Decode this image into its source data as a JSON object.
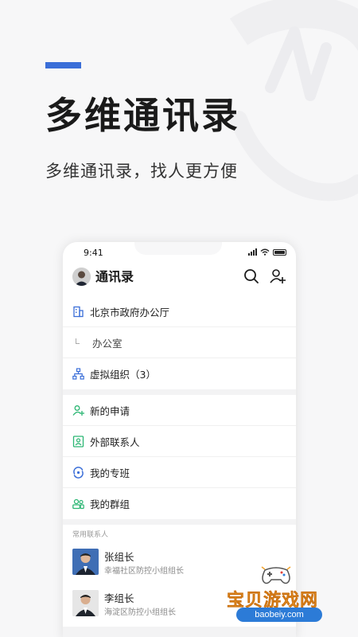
{
  "hero": {
    "title": "多维通讯录",
    "subtitle": "多维通讯录，找人更方便"
  },
  "phone": {
    "status_time": "9:41",
    "header_title": "通讯录",
    "org": [
      {
        "label": "北京市政府办公厅",
        "icon": "building-icon"
      },
      {
        "label": "办公室",
        "icon": "branch-icon"
      },
      {
        "label": "虚拟组织（3）",
        "icon": "org-tree-icon"
      }
    ],
    "menu": [
      {
        "label": "新的申请",
        "icon": "new-request-icon"
      },
      {
        "label": "外部联系人",
        "icon": "external-contact-icon"
      },
      {
        "label": "我的专班",
        "icon": "special-team-icon"
      },
      {
        "label": "我的群组",
        "icon": "group-icon"
      }
    ],
    "frequent_label": "常用联系人",
    "contacts": [
      {
        "name": "张组长",
        "title": "幸福社区防控小组组长"
      },
      {
        "name": "李组长",
        "title": "海淀区防控小组组长"
      }
    ]
  },
  "watermark": {
    "text": "宝贝游戏网",
    "url": "baobeiy.com"
  },
  "colors": {
    "accent": "#3a6ed8",
    "green": "#2bb673",
    "blue": "#3a6ed8"
  }
}
